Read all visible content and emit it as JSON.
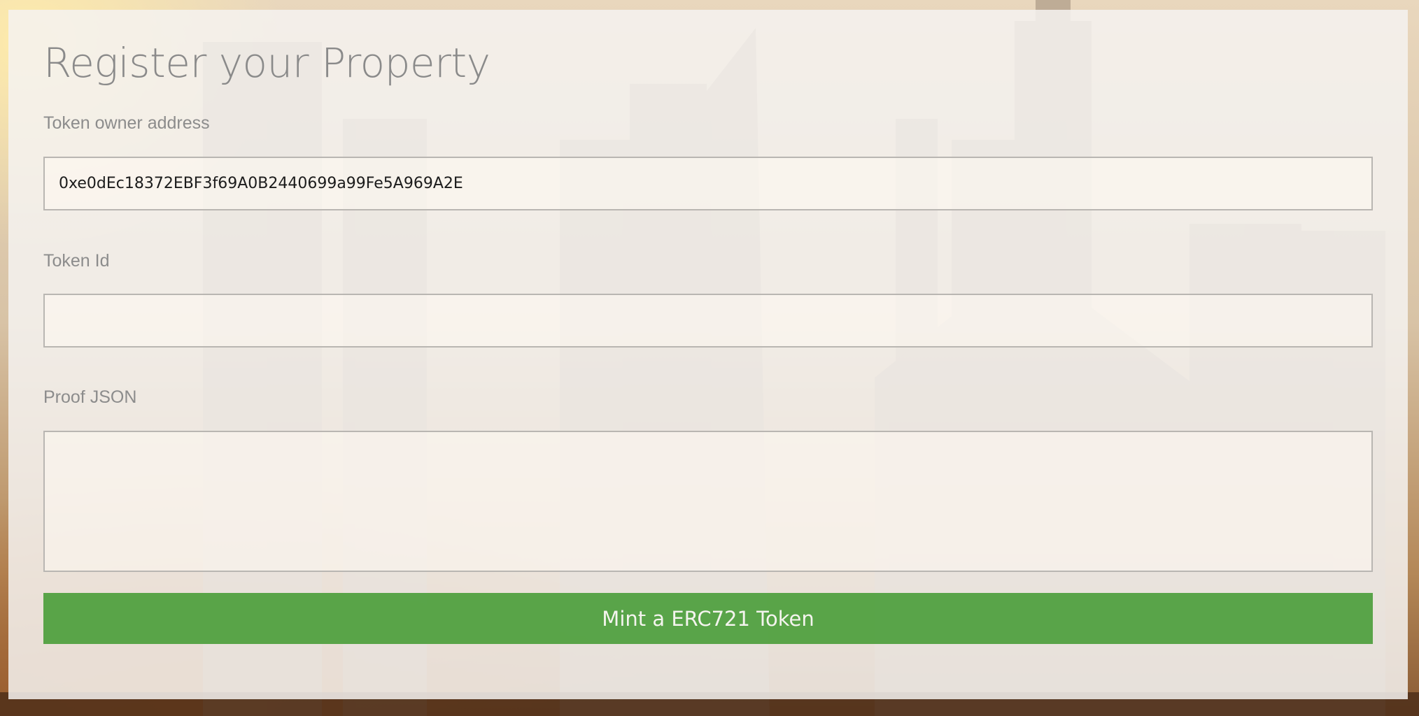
{
  "form": {
    "title": "Register your Property",
    "owner_label": "Token owner address",
    "owner_value": "0xe0dEc18372EBF3f69A0B2440699a99Fe5A969A2E",
    "token_id_label": "Token Id",
    "token_id_value": "",
    "proof_label": "Proof JSON",
    "proof_value": "",
    "mint_button_label": "Mint a ERC721 Token"
  },
  "colors": {
    "mint_button": "#4c9e3c",
    "title_text": "#8a8a8a",
    "label_text": "#8c8c8c"
  }
}
